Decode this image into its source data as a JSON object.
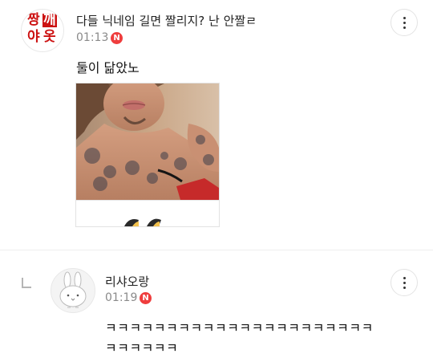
{
  "colors": {
    "badge_red": "#ef3d3d",
    "time_gray": "#8a8a8a",
    "divider": "#eeeeee"
  },
  "comment1": {
    "avatar_text": [
      "짱",
      "깨",
      "야",
      "옷"
    ],
    "author": "다들 닉네임 길면 짤리지? 난 안짤ㄹ",
    "time": "01:13",
    "badge": "N",
    "text": "둘이 닮았노",
    "more_icon": "more-vertical-icon"
  },
  "comment2": {
    "reply_icon": "reply-arrow-icon",
    "avatar_icon": "bunny-icon",
    "author": "리샤오랑",
    "time": "01:19",
    "badge": "N",
    "text_line1": "ㅋㅋㅋㅋㅋㅋㅋㅋㅋㅋㅋㅋㅋㅋㅋㅋㅋㅋㅋㅋㅋㅋ",
    "text_line2": "ㅋㅋㅋㅋㅋㅋ",
    "more_icon": "more-vertical-icon"
  }
}
